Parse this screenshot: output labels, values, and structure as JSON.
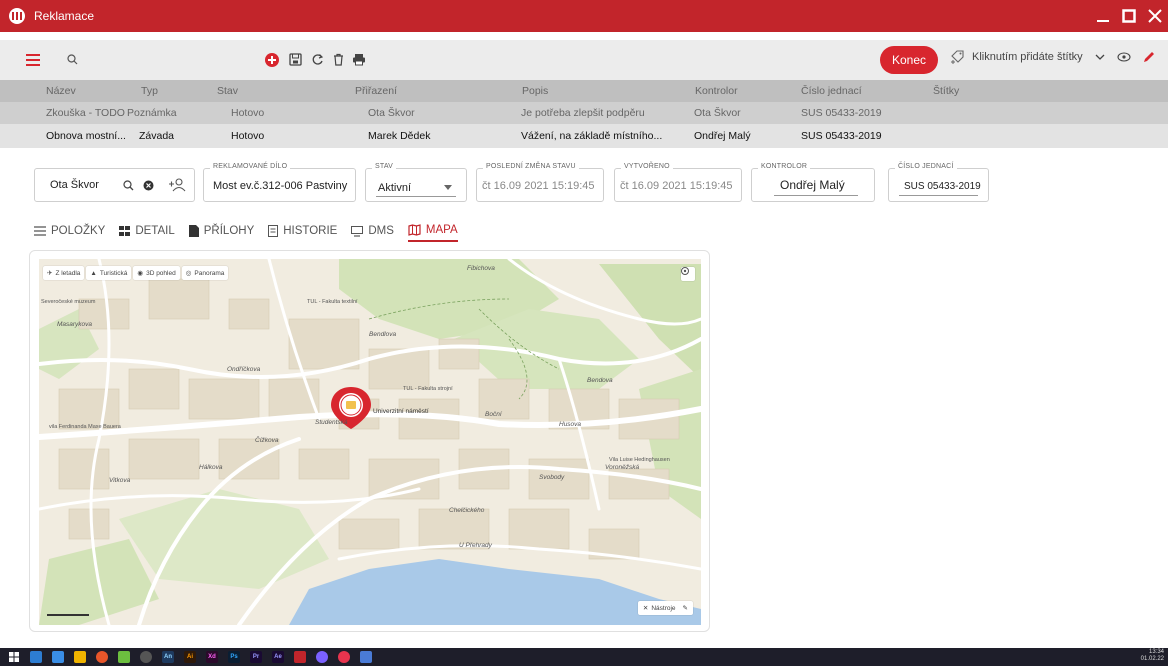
{
  "window": {
    "title": "Reklamace"
  },
  "toolbar": {
    "konec_label": "Konec",
    "tag_hint": "Kliknutím přidáte štítky"
  },
  "table": {
    "columns": [
      "Název",
      "Typ",
      "Stav",
      "Přiřazení",
      "Popis",
      "Kontrolor",
      "Číslo jednací",
      "Štítky"
    ],
    "rows": [
      [
        "Zkouška - TODO",
        "Poznámka",
        "Hotovo",
        "Ota Škvor",
        "Je potřeba zlepšit podpěru",
        "Ota Škvor",
        "SUS 05433-2019",
        ""
      ],
      [
        "Obnova mostní...",
        "Závada",
        "Hotovo",
        "Marek Dědek",
        "Vážení, na základě místního...",
        "Ondřej Malý",
        "SUS 05433-2019",
        ""
      ]
    ]
  },
  "form": {
    "user_filter": "Ota Škvor",
    "dilo_label": "REKLAMOVANÉ DÍLO",
    "dilo_value": "Most ev.č.312-006 Pastviny",
    "stav_label": "STAV",
    "stav_value": "Aktivní",
    "zmena_label": "POSLEDNÍ ZMĚNA STAVU",
    "zmena_value": "čt 16.09 2021 15:19:45",
    "vytvoreno_label": "VYTVOŘENO",
    "vytvoreno_value": "čt 16.09 2021 15:19:45",
    "kontrolor_label": "KONTROLOR",
    "kontrolor_value": "Ondřej Malý",
    "cislo_label": "ČÍSLO JEDNACÍ",
    "cislo_value": "SUS 05433-2019"
  },
  "tabs": [
    {
      "label": "POLOŽKY",
      "icon": "list-icon"
    },
    {
      "label": "DETAIL",
      "icon": "grid-icon"
    },
    {
      "label": "PŘÍLOHY",
      "icon": "file-icon"
    },
    {
      "label": "HISTORIE",
      "icon": "history-icon"
    },
    {
      "label": "DMS",
      "icon": "monitor-icon"
    },
    {
      "label": "MAPA",
      "icon": "map-icon",
      "active": true
    }
  ],
  "map": {
    "tools": [
      "Z letadla",
      "Turistická",
      "3D pohled",
      "Panorama"
    ],
    "nastroje": "Nástroje",
    "streets": [
      "Fibichova",
      "Masarykova",
      "Bendlova",
      "Ondříčkova",
      "Husova",
      "Čížkova",
      "Boční",
      "Svobody",
      "Chelčického",
      "U Přehrady",
      "Vitkova",
      "Hálkova",
      "Studentská",
      "Voroněžská",
      "Bendova"
    ],
    "pois": [
      "Univerzitní náměstí",
      "TUL - Fakulta strojní",
      "TUL - Fakulta textilní",
      "Severočeské muzeum",
      "vila Ferdinanda Maxe Bauera",
      "Vila Luise Hedinghausen"
    ]
  },
  "taskbar": {
    "apps": [
      "An",
      "Ai",
      "Xd",
      "Ps",
      "Pr",
      "Ae"
    ],
    "time": "13:34",
    "date": "01.02.22"
  },
  "colors": {
    "brand": "#c2252b",
    "accent": "#d8262e"
  }
}
